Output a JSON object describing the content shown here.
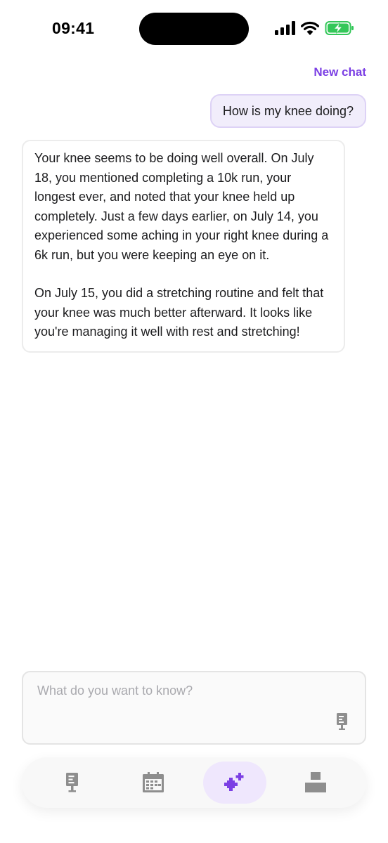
{
  "status_bar": {
    "time": "09:41"
  },
  "header": {
    "new_chat_label": "New chat"
  },
  "conversation": {
    "user_message": "How is my knee doing?",
    "assistant_paragraphs": [
      "Your knee seems to be doing well overall. On July 18, you mentioned completing a 10k run, your longest ever, and noted that your knee held up completely. Just a few days earlier, on July 14, you experienced some aching in your right knee during a 6k run, but you were keeping an eye on it.",
      "On July 15, you did a stretching routine and felt that your knee was much better afterward. It looks like you're managing it well with rest and stretching!"
    ]
  },
  "composer": {
    "placeholder": "What do you want to know?",
    "value": ""
  },
  "tab_bar": {
    "tabs": [
      {
        "icon": "journal-icon",
        "active": false
      },
      {
        "icon": "calendar-icon",
        "active": false
      },
      {
        "icon": "sparkle-icon",
        "active": true
      },
      {
        "icon": "profile-icon",
        "active": false
      }
    ]
  },
  "colors": {
    "accent": "#7b3fe4",
    "user_bubble_bg": "#f1edfb",
    "icon_gray": "#8e8e8e",
    "battery_green": "#34c759"
  }
}
